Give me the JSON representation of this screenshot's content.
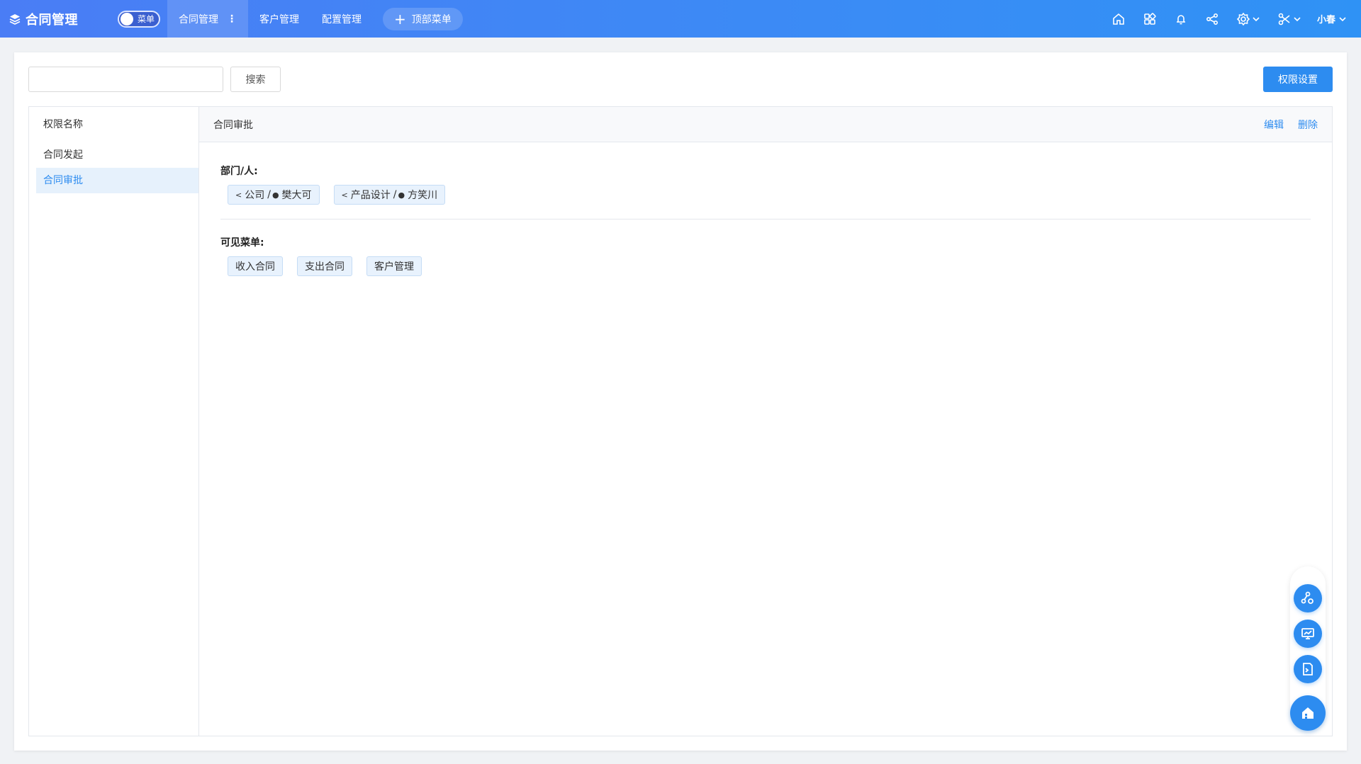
{
  "app": {
    "title": "合同管理",
    "menu_toggle_label": "菜单"
  },
  "nav": {
    "items": [
      {
        "label": "合同管理",
        "active": true
      },
      {
        "label": "客户管理"
      },
      {
        "label": "配置管理"
      }
    ],
    "more_icon": "⋮",
    "top_menu_label": "顶部菜单"
  },
  "header_icons": [
    "home-icon",
    "apps-icon",
    "bell-icon",
    "share-icon",
    "settings-icon",
    "tools-icon"
  ],
  "user": {
    "name": "小春"
  },
  "toolbar": {
    "search_placeholder": "",
    "search_label": "搜索",
    "perm_settings_label": "权限设置"
  },
  "left": {
    "header": "权限名称",
    "items": [
      {
        "label": "合同发起"
      },
      {
        "label": "合同审批",
        "selected": true
      }
    ]
  },
  "detail": {
    "title": "合同审批",
    "edit_label": "编辑",
    "delete_label": "删除",
    "dept_title": "部门/人:",
    "dept_tags": [
      {
        "dept": "公司",
        "sep": "/",
        "person": "樊大可"
      },
      {
        "dept": "产品设计",
        "sep": "/",
        "person": "方笑川"
      }
    ],
    "menu_title": "可见菜单:",
    "menu_tags": [
      "收入合同",
      "支出合同",
      "客户管理"
    ]
  },
  "floating": [
    "workflow-icon",
    "monitor-chart-icon",
    "terminal-doc-icon",
    "home-building-icon"
  ],
  "colors": {
    "primary": "#2d8cf0",
    "topbar": "#3b8bf5",
    "tag_bg": "#e8f2fd"
  }
}
